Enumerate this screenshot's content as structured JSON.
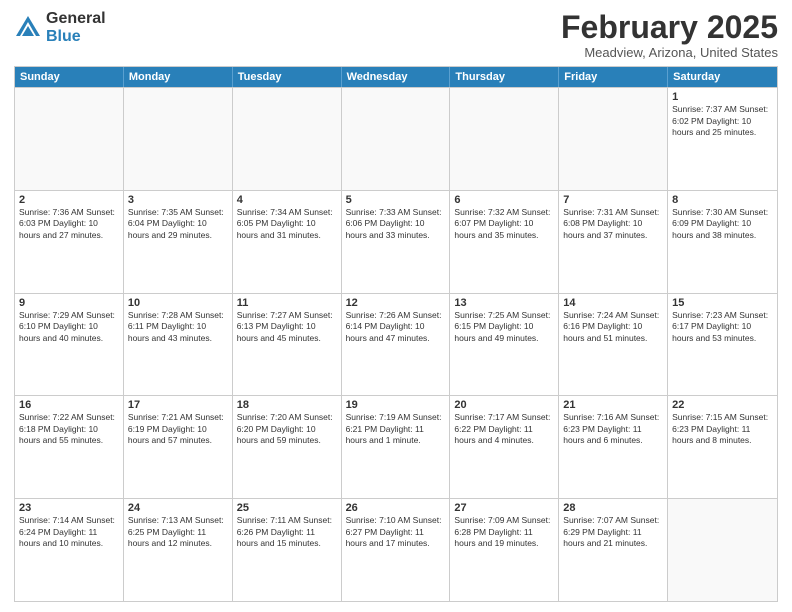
{
  "logo": {
    "general": "General",
    "blue": "Blue"
  },
  "header": {
    "month": "February 2025",
    "location": "Meadview, Arizona, United States"
  },
  "days_of_week": [
    "Sunday",
    "Monday",
    "Tuesday",
    "Wednesday",
    "Thursday",
    "Friday",
    "Saturday"
  ],
  "weeks": [
    [
      {
        "day": "",
        "info": ""
      },
      {
        "day": "",
        "info": ""
      },
      {
        "day": "",
        "info": ""
      },
      {
        "day": "",
        "info": ""
      },
      {
        "day": "",
        "info": ""
      },
      {
        "day": "",
        "info": ""
      },
      {
        "day": "1",
        "info": "Sunrise: 7:37 AM\nSunset: 6:02 PM\nDaylight: 10 hours and 25 minutes."
      }
    ],
    [
      {
        "day": "2",
        "info": "Sunrise: 7:36 AM\nSunset: 6:03 PM\nDaylight: 10 hours and 27 minutes."
      },
      {
        "day": "3",
        "info": "Sunrise: 7:35 AM\nSunset: 6:04 PM\nDaylight: 10 hours and 29 minutes."
      },
      {
        "day": "4",
        "info": "Sunrise: 7:34 AM\nSunset: 6:05 PM\nDaylight: 10 hours and 31 minutes."
      },
      {
        "day": "5",
        "info": "Sunrise: 7:33 AM\nSunset: 6:06 PM\nDaylight: 10 hours and 33 minutes."
      },
      {
        "day": "6",
        "info": "Sunrise: 7:32 AM\nSunset: 6:07 PM\nDaylight: 10 hours and 35 minutes."
      },
      {
        "day": "7",
        "info": "Sunrise: 7:31 AM\nSunset: 6:08 PM\nDaylight: 10 hours and 37 minutes."
      },
      {
        "day": "8",
        "info": "Sunrise: 7:30 AM\nSunset: 6:09 PM\nDaylight: 10 hours and 38 minutes."
      }
    ],
    [
      {
        "day": "9",
        "info": "Sunrise: 7:29 AM\nSunset: 6:10 PM\nDaylight: 10 hours and 40 minutes."
      },
      {
        "day": "10",
        "info": "Sunrise: 7:28 AM\nSunset: 6:11 PM\nDaylight: 10 hours and 43 minutes."
      },
      {
        "day": "11",
        "info": "Sunrise: 7:27 AM\nSunset: 6:13 PM\nDaylight: 10 hours and 45 minutes."
      },
      {
        "day": "12",
        "info": "Sunrise: 7:26 AM\nSunset: 6:14 PM\nDaylight: 10 hours and 47 minutes."
      },
      {
        "day": "13",
        "info": "Sunrise: 7:25 AM\nSunset: 6:15 PM\nDaylight: 10 hours and 49 minutes."
      },
      {
        "day": "14",
        "info": "Sunrise: 7:24 AM\nSunset: 6:16 PM\nDaylight: 10 hours and 51 minutes."
      },
      {
        "day": "15",
        "info": "Sunrise: 7:23 AM\nSunset: 6:17 PM\nDaylight: 10 hours and 53 minutes."
      }
    ],
    [
      {
        "day": "16",
        "info": "Sunrise: 7:22 AM\nSunset: 6:18 PM\nDaylight: 10 hours and 55 minutes."
      },
      {
        "day": "17",
        "info": "Sunrise: 7:21 AM\nSunset: 6:19 PM\nDaylight: 10 hours and 57 minutes."
      },
      {
        "day": "18",
        "info": "Sunrise: 7:20 AM\nSunset: 6:20 PM\nDaylight: 10 hours and 59 minutes."
      },
      {
        "day": "19",
        "info": "Sunrise: 7:19 AM\nSunset: 6:21 PM\nDaylight: 11 hours and 1 minute."
      },
      {
        "day": "20",
        "info": "Sunrise: 7:17 AM\nSunset: 6:22 PM\nDaylight: 11 hours and 4 minutes."
      },
      {
        "day": "21",
        "info": "Sunrise: 7:16 AM\nSunset: 6:23 PM\nDaylight: 11 hours and 6 minutes."
      },
      {
        "day": "22",
        "info": "Sunrise: 7:15 AM\nSunset: 6:23 PM\nDaylight: 11 hours and 8 minutes."
      }
    ],
    [
      {
        "day": "23",
        "info": "Sunrise: 7:14 AM\nSunset: 6:24 PM\nDaylight: 11 hours and 10 minutes."
      },
      {
        "day": "24",
        "info": "Sunrise: 7:13 AM\nSunset: 6:25 PM\nDaylight: 11 hours and 12 minutes."
      },
      {
        "day": "25",
        "info": "Sunrise: 7:11 AM\nSunset: 6:26 PM\nDaylight: 11 hours and 15 minutes."
      },
      {
        "day": "26",
        "info": "Sunrise: 7:10 AM\nSunset: 6:27 PM\nDaylight: 11 hours and 17 minutes."
      },
      {
        "day": "27",
        "info": "Sunrise: 7:09 AM\nSunset: 6:28 PM\nDaylight: 11 hours and 19 minutes."
      },
      {
        "day": "28",
        "info": "Sunrise: 7:07 AM\nSunset: 6:29 PM\nDaylight: 11 hours and 21 minutes."
      },
      {
        "day": "",
        "info": ""
      }
    ]
  ]
}
